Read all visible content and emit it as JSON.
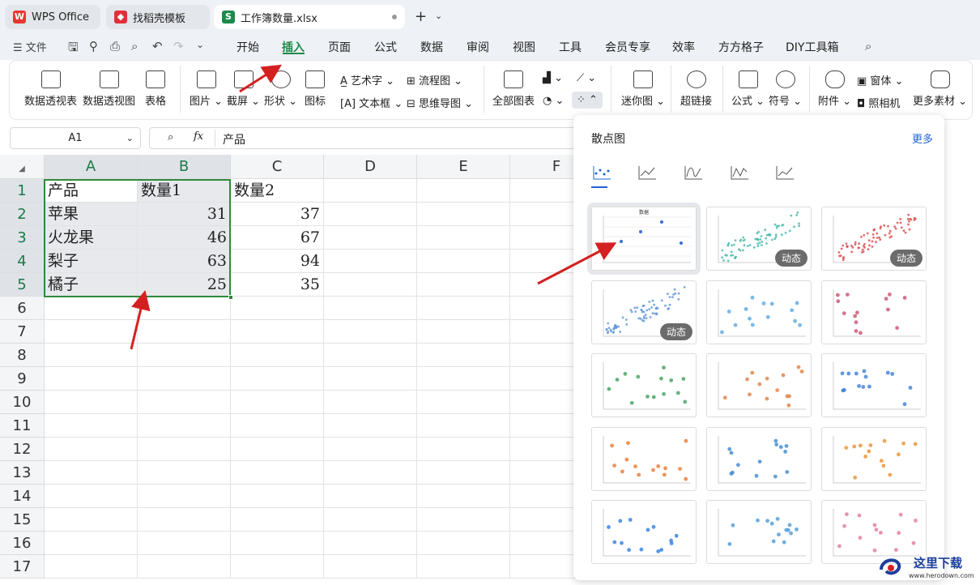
{
  "tabs": {
    "wps": "WPS Office",
    "templates": "找稻壳模板",
    "workbook": "工作簿数量.xlsx"
  },
  "menu": {
    "file": "文件",
    "items": [
      "开始",
      "插入",
      "页面",
      "公式",
      "数据",
      "审阅",
      "视图",
      "工具",
      "会员专享",
      "效率",
      "方方格子",
      "DIY工具箱"
    ]
  },
  "ribbon": {
    "pivot_table": "数据透视表",
    "pivot_chart": "数据透视图",
    "table": "表格",
    "picture": "图片",
    "screenshot": "截屏",
    "shape": "形状",
    "icon": "图标",
    "wordart": "艺术字",
    "textbox": "文本框",
    "flowchart": "流程图",
    "mindmap": "思维导图",
    "all_charts": "全部图表",
    "sparkline": "迷你图",
    "hyperlink": "超链接",
    "formula": "公式",
    "symbol": "符号",
    "attachment": "附件",
    "window": "窗体",
    "camera": "照相机",
    "more_material": "更多素材"
  },
  "formula_bar": {
    "name_box": "A1",
    "fx": "fx",
    "content": "产品"
  },
  "columns": [
    "A",
    "B",
    "C",
    "D",
    "E",
    "F"
  ],
  "rows": [
    "1",
    "2",
    "3",
    "4",
    "5",
    "6",
    "7",
    "8",
    "9",
    "10",
    "11",
    "12",
    "13",
    "14",
    "15",
    "16",
    "17"
  ],
  "sheet": {
    "A": [
      "产品",
      "苹果",
      "火龙果",
      "梨子",
      "橘子"
    ],
    "B": [
      "数量1",
      "31",
      "46",
      "63",
      "25"
    ],
    "C": [
      "数量2",
      "37",
      "67",
      "94",
      "35"
    ]
  },
  "panel": {
    "title": "散点图",
    "more": "更多",
    "badge": "动态",
    "first_thumb_title": "数据"
  },
  "watermark": {
    "text": "这里下载",
    "url": "www.herodown.com"
  },
  "colors": {
    "accent_green": "#1b8a4a",
    "selection_border": "#2e8a3c",
    "link_blue": "#1e64d6",
    "arrow_red": "#d42020"
  }
}
